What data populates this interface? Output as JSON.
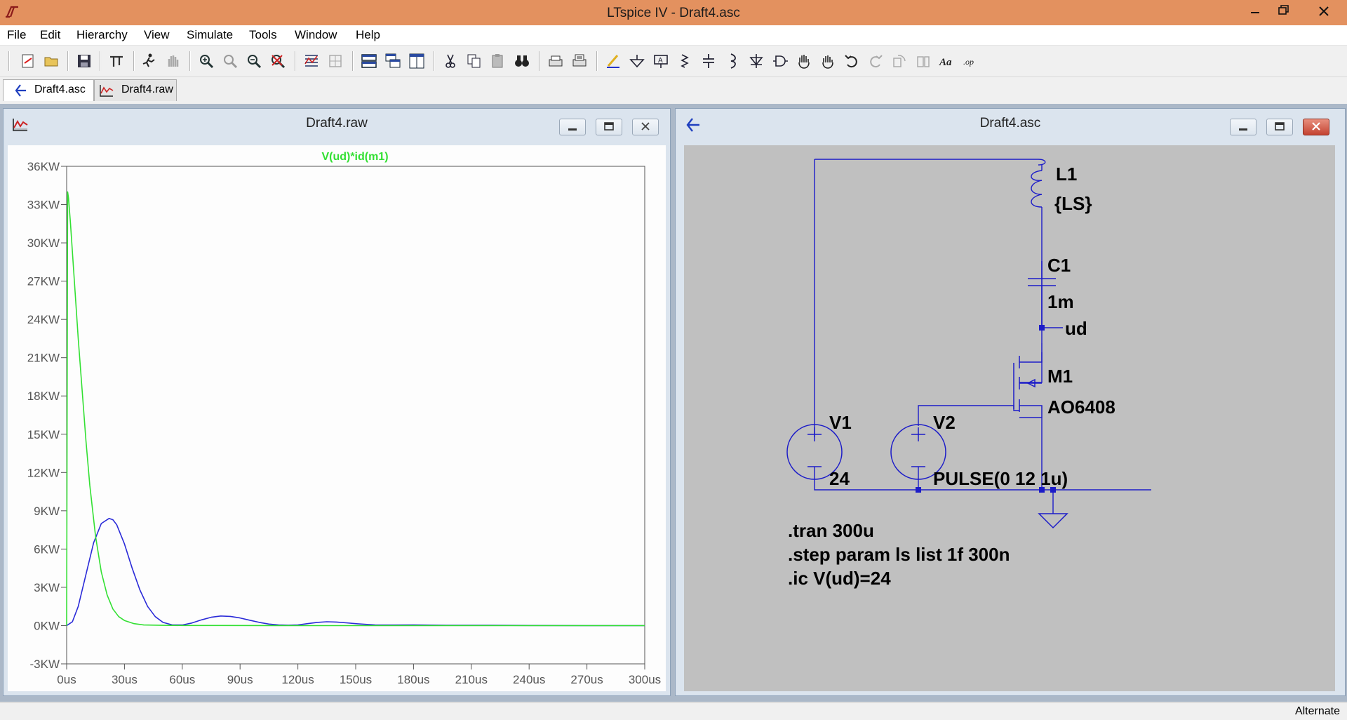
{
  "window": {
    "title": "LTspice IV - Draft4.asc"
  },
  "menu": [
    "File",
    "Edit",
    "Hierarchy",
    "View",
    "Simulate",
    "Tools",
    "Window",
    "Help"
  ],
  "tabs": [
    {
      "label": "Draft4.asc",
      "active": true
    },
    {
      "label": "Draft4.raw",
      "active": false
    }
  ],
  "waveform_window": {
    "title": "Draft4.raw",
    "trace_label": "V(ud)*id(m1)"
  },
  "chart_data": {
    "type": "line",
    "title": "V(ud)*id(m1)",
    "xlabel": "",
    "ylabel": "",
    "xlim": [
      0,
      300
    ],
    "ylim": [
      -3,
      36
    ],
    "x_ticks": [
      "0us",
      "30us",
      "60us",
      "90us",
      "120us",
      "150us",
      "180us",
      "210us",
      "240us",
      "270us",
      "300us"
    ],
    "y_ticks": [
      "-3KW",
      "0KW",
      "3KW",
      "6KW",
      "9KW",
      "12KW",
      "15KW",
      "18KW",
      "21KW",
      "24KW",
      "27KW",
      "30KW",
      "33KW",
      "36KW"
    ],
    "series": [
      {
        "name": "V(ud)*id(m1)",
        "color": "#33e033",
        "x": [
          0,
          0.5,
          1,
          2,
          4,
          6,
          8,
          10,
          12,
          15,
          18,
          21,
          24,
          27,
          30,
          35,
          40,
          50,
          60,
          80,
          120,
          180,
          240,
          300
        ],
        "y": [
          0,
          34,
          33.5,
          31.5,
          27,
          22.5,
          18.5,
          14.5,
          11,
          7,
          4.2,
          2.4,
          1.3,
          0.7,
          0.4,
          0.15,
          0.05,
          0.02,
          0.01,
          0.01,
          0,
          0,
          0,
          0
        ]
      },
      {
        "name": "",
        "color": "#2b2bd8",
        "x": [
          0,
          3,
          6,
          10,
          14,
          18,
          22,
          24,
          26,
          30,
          34,
          38,
          42,
          46,
          50,
          55,
          60,
          65,
          70,
          75,
          80,
          85,
          90,
          95,
          100,
          105,
          110,
          115,
          120,
          125,
          130,
          135,
          140,
          145,
          150,
          160,
          170,
          180,
          200,
          220,
          240,
          270,
          300
        ],
        "y": [
          0,
          0.3,
          1.5,
          4,
          6.5,
          8,
          8.4,
          8.3,
          7.9,
          6.4,
          4.5,
          2.8,
          1.5,
          0.7,
          0.25,
          0.05,
          0.05,
          0.2,
          0.45,
          0.65,
          0.75,
          0.72,
          0.6,
          0.42,
          0.25,
          0.12,
          0.05,
          0.03,
          0.05,
          0.15,
          0.25,
          0.3,
          0.28,
          0.22,
          0.15,
          0.05,
          0.04,
          0.05,
          0.02,
          0.02,
          0.01,
          0,
          0
        ]
      }
    ]
  },
  "schematic_window": {
    "title": "Draft4.asc",
    "components": {
      "L1": {
        "name": "L1",
        "value": "{LS}"
      },
      "C1": {
        "name": "C1",
        "value": "1m"
      },
      "M1": {
        "name": "M1",
        "value": "AO6408"
      },
      "V1": {
        "name": "V1",
        "value": "24"
      },
      "V2": {
        "name": "V2",
        "value": "PULSE(0 12 1u)"
      },
      "net": "ud"
    },
    "directives": [
      ".tran 300u",
      ".step param ls list 1f 300n",
      ".ic V(ud)=24"
    ]
  },
  "status": {
    "text": "Alternate"
  }
}
